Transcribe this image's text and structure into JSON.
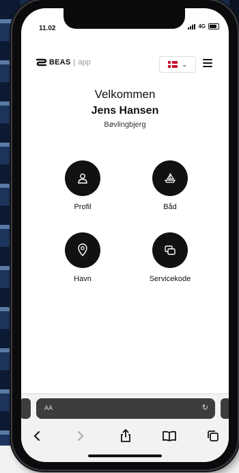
{
  "status": {
    "time": "11.02",
    "network": "4G"
  },
  "header": {
    "logo_brand": "BEAS",
    "logo_suffix": "app",
    "language_chevron": "⌄"
  },
  "welcome": {
    "greeting": "Velkommen",
    "name": "Jens Hansen",
    "location": "Bøvlingbjerg"
  },
  "tiles": [
    {
      "label": "Profil",
      "icon": "user-icon"
    },
    {
      "label": "Båd",
      "icon": "boat-icon"
    },
    {
      "label": "Havn",
      "icon": "location-pin-icon"
    },
    {
      "label": "Servicekode",
      "icon": "cards-icon"
    }
  ],
  "browser": {
    "text_size_label": "AA",
    "reload_glyph": "↻"
  },
  "colors": {
    "icon_circle": "#111111",
    "flag_red": "#c8102e",
    "background": "#ffffff"
  }
}
